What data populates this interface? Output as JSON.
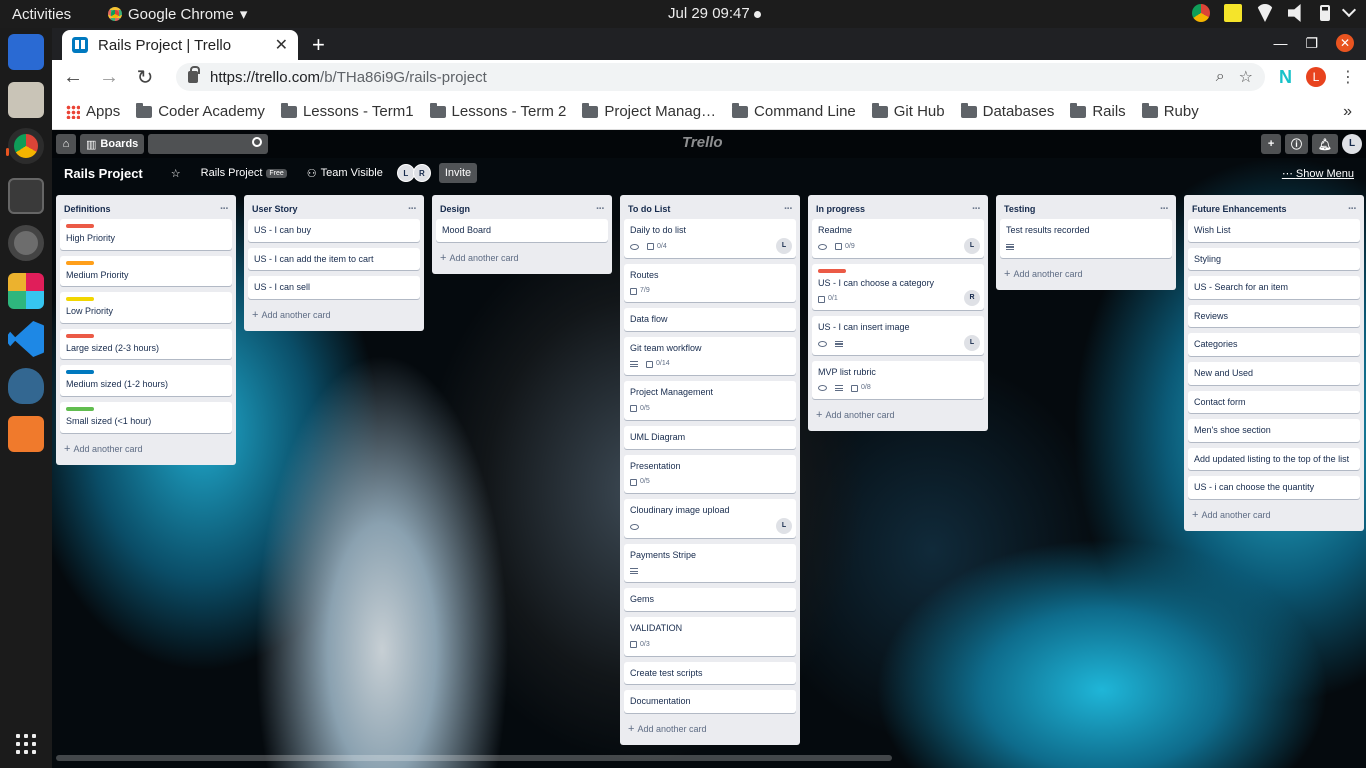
{
  "topbar": {
    "activities": "Activities",
    "app_name": "Google Chrome",
    "clock": "Jul 29  09:47"
  },
  "dock": {
    "icons": [
      "document-icon",
      "files-icon",
      "chrome-icon",
      "terminal-icon",
      "settings-icon",
      "slack-icon",
      "vscode-icon",
      "postgres-icon",
      "calculator-icon",
      "app-grid-icon"
    ]
  },
  "chrome": {
    "tab_title": "Rails Project | Trello",
    "tab_close": "✕",
    "new_tab": "+",
    "url_host": "https://trello.com",
    "url_path": "/b/THa86i9G/rails-project",
    "profile_initial": "L",
    "bookmarks": [
      "Apps",
      "Coder Academy",
      "Lessons - Term1",
      "Lessons - Term 2",
      "Project Manag…",
      "Command Line",
      "Git Hub",
      "Databases",
      "Rails",
      "Ruby"
    ],
    "more_bookmarks": "»"
  },
  "trello": {
    "boards_label": "Boards",
    "logo": "Trello",
    "user_initial": "L",
    "board_name": "Rails Project",
    "team_label": "Rails Project",
    "free_badge": "Free",
    "visibility": "Team Visible",
    "members": [
      "L",
      "R"
    ],
    "invite": "Invite",
    "show_menu": "Show Menu",
    "add_card": "Add another card"
  },
  "lists": [
    {
      "title": "Definitions",
      "cards": [
        {
          "title": "High Priority",
          "label": "#eb5a46"
        },
        {
          "title": "Medium Priority",
          "label": "#ff9f1a"
        },
        {
          "title": "Low Priority",
          "label": "#f2d600"
        },
        {
          "title": "Large sized (2-3 hours)",
          "label": "#eb5a46"
        },
        {
          "title": "Medium sized (1-2 hours)",
          "label": "#0079bf"
        },
        {
          "title": "Small sized (<1 hour)",
          "label": "#61bd4f"
        }
      ]
    },
    {
      "title": "User Story",
      "cards": [
        {
          "title": "US - I can buy"
        },
        {
          "title": "US - I can add the item to cart"
        },
        {
          "title": "US - I can sell"
        }
      ]
    },
    {
      "title": "Design",
      "cards": [
        {
          "title": "Mood Board"
        }
      ]
    },
    {
      "title": "To do List",
      "cards": [
        {
          "title": "Daily to do list",
          "watch": true,
          "checklist": "0/4",
          "member": "L"
        },
        {
          "title": "Routes",
          "checklist": "7/9"
        },
        {
          "title": "Data flow"
        },
        {
          "title": "Git team workflow",
          "desc": true,
          "checklist": "0/14"
        },
        {
          "title": "Project Management",
          "checklist": "0/5"
        },
        {
          "title": "UML Diagram"
        },
        {
          "title": "Presentation",
          "checklist": "0/5"
        },
        {
          "title": "Cloudinary image upload",
          "watch": true,
          "member": "L"
        },
        {
          "title": "Payments Stripe",
          "desc": true
        },
        {
          "title": "Gems"
        },
        {
          "title": "VALIDATION",
          "checklist": "0/3"
        },
        {
          "title": "Create test scripts"
        },
        {
          "title": "Documentation"
        }
      ]
    },
    {
      "title": "In progress",
      "cards": [
        {
          "title": "Readme",
          "watch": true,
          "checklist": "0/9",
          "member": "L"
        },
        {
          "title": "US - I can choose a category",
          "label": "#eb5a46",
          "checklist": "0/1",
          "member": "R"
        },
        {
          "title": "US - I can insert image",
          "watch": true,
          "desc": true,
          "member": "L"
        },
        {
          "title": "MVP list rubric",
          "watch": true,
          "desc": true,
          "checklist": "0/8"
        }
      ]
    },
    {
      "title": "Testing",
      "cards": [
        {
          "title": "Test results recorded",
          "desc": true
        }
      ]
    },
    {
      "title": "Future Enhancements",
      "cards": [
        {
          "title": "Wish List"
        },
        {
          "title": "Styling"
        },
        {
          "title": "US - Search for an item"
        },
        {
          "title": "Reviews"
        },
        {
          "title": "Categories"
        },
        {
          "title": "New and Used"
        },
        {
          "title": "Contact form"
        },
        {
          "title": "Men's shoe section"
        },
        {
          "title": "Add updated listing to the top of the list"
        },
        {
          "title": "US - i can choose the quantity"
        }
      ]
    }
  ]
}
